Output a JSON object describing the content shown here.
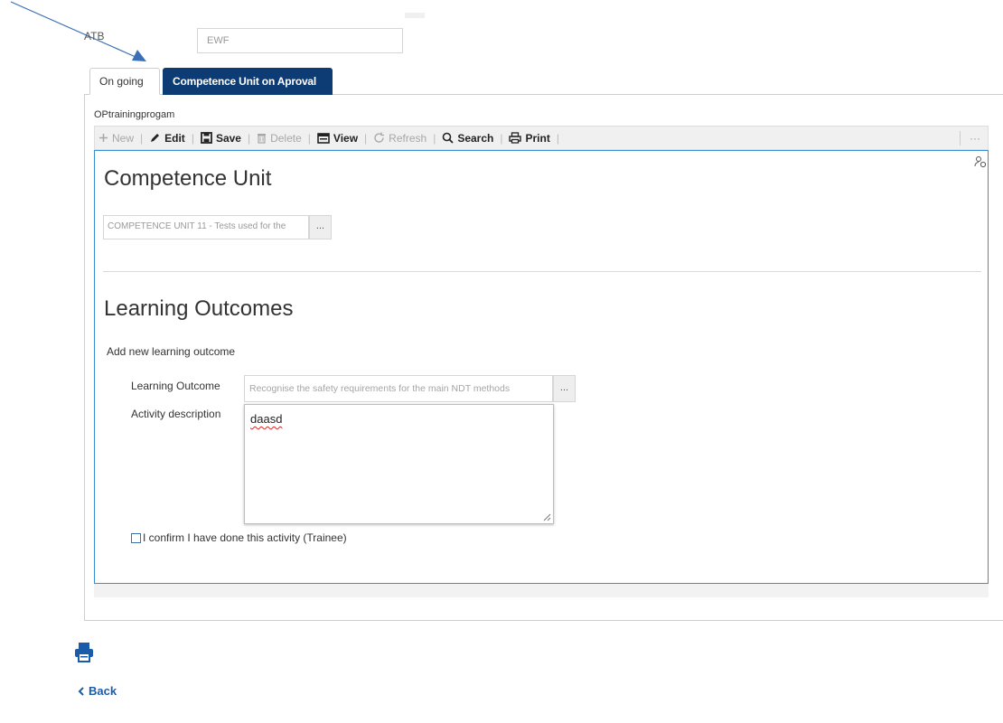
{
  "header": {
    "atb_label": "ATB",
    "atb_value": "EWF"
  },
  "tabs": [
    {
      "label": "On going",
      "active": true
    },
    {
      "label": "Competence Unit on Aproval",
      "active": false
    }
  ],
  "entity_name": "OPtrainingprogam",
  "toolbar": {
    "new": "New",
    "edit": "Edit",
    "save": "Save",
    "delete": "Delete",
    "view": "View",
    "refresh": "Refresh",
    "search": "Search",
    "print": "Print",
    "more": "···"
  },
  "competence_unit": {
    "title": "Competence Unit",
    "value": "COMPETENCE UNIT 11 - Tests used for the",
    "lookup_button": "..."
  },
  "learning_outcomes": {
    "title": "Learning Outcomes",
    "add_text": "Add new learning outcome",
    "outcome_label": "Learning Outcome",
    "outcome_value": "Recognise the safety requirements for the main NDT methods",
    "lookup_button": "...",
    "activity_label": "Activity description",
    "activity_value": "daasd",
    "confirm_label": "I confirm I have done this activity (Trainee)"
  },
  "footer": {
    "back_label": "Back"
  },
  "colors": {
    "tab_active_bg": "#0d3b73",
    "form_border": "#3a8fd0",
    "back_link": "#1a5ca8",
    "arrow": "#3b6fb6"
  },
  "icons": [
    "plus-icon",
    "pencil-icon",
    "floppy-disk-icon",
    "trash-icon",
    "window-icon",
    "refresh-icon",
    "magnifier-icon",
    "printer-icon",
    "user-settings-icon",
    "chevron-left-icon"
  ]
}
